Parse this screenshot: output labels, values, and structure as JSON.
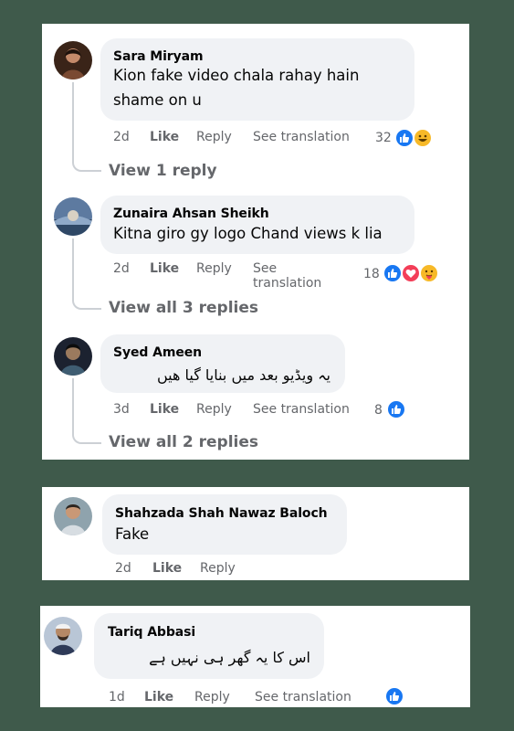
{
  "comments": [
    {
      "author": "Sara Miryam",
      "text_line1": "Kion fake video chala rahay hain",
      "text_line2": "shame on u",
      "time": "2d",
      "like": "Like",
      "reply": "Reply",
      "translation": "See translation",
      "reaction_count": "32",
      "reactions": [
        "like",
        "haha"
      ],
      "replies_link": "View 1 reply"
    },
    {
      "author": "Zunaira Ahsan Sheikh",
      "text": "Kitna giro gy logo Chand views k lia",
      "time": "2d",
      "like": "Like",
      "reply": "Reply",
      "translation_line1": "See",
      "translation_line2": "translation",
      "reaction_count": "18",
      "reactions": [
        "like",
        "love",
        "care"
      ],
      "replies_link": "View all 3 replies"
    },
    {
      "author": "Syed Ameen",
      "text": "یہ ویڈیو بعد میں بنایا گیا ھیں",
      "time": "3d",
      "like": "Like",
      "reply": "Reply",
      "translation": "See translation",
      "reaction_count": "8",
      "reactions": [
        "like"
      ],
      "replies_link": "View all 2 replies"
    },
    {
      "author": "Shahzada Shah Nawaz Baloch",
      "text": "Fake",
      "time": "2d",
      "like": "Like",
      "reply": "Reply"
    },
    {
      "author": "Tariq Abbasi",
      "text": "اس کا یہ گھر ہی نہیں ہے",
      "time": "1d",
      "like": "Like",
      "reply": "Reply",
      "translation": "See translation",
      "reactions": [
        "like"
      ]
    }
  ],
  "colors": {
    "background": "#3f5a4b",
    "bubble": "#f0f2f5",
    "meta_text": "#65676b",
    "like_blue": "#1877f2",
    "love_red": "#f33e58",
    "haha_yellow": "#f7b928"
  }
}
